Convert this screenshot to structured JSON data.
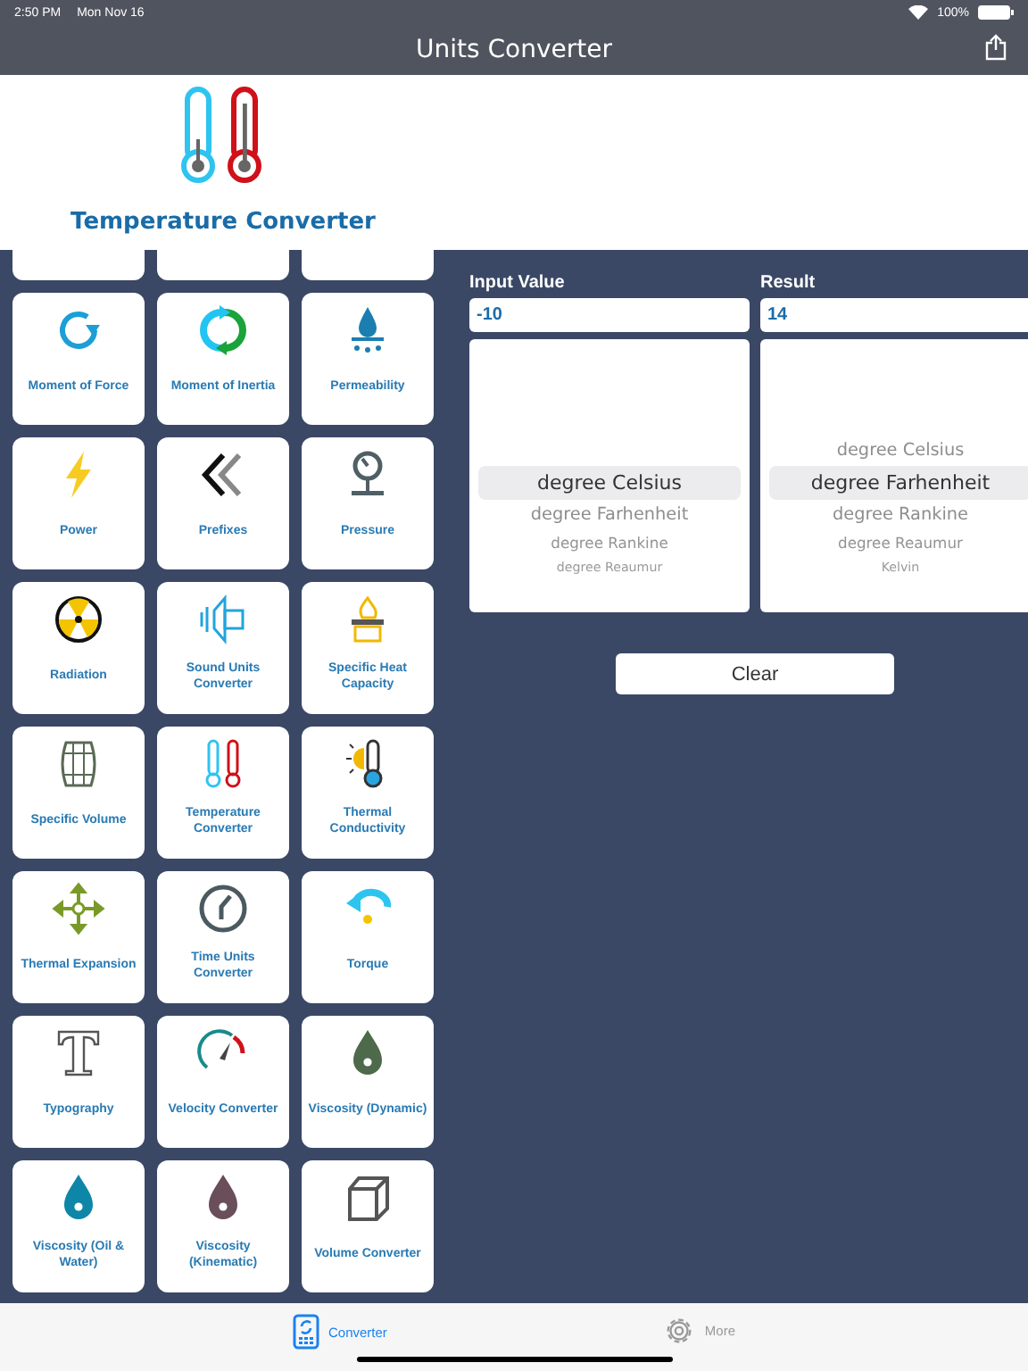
{
  "status_bar": {
    "time": "2:50 PM",
    "date": "Mon Nov 16",
    "battery": "100%"
  },
  "nav_bar": {
    "title": "Units Converter"
  },
  "header": {
    "title": "Temperature Converter"
  },
  "categories": [
    {
      "label": "Moment of Force"
    },
    {
      "label": "Moment of Inertia"
    },
    {
      "label": "Permeability"
    },
    {
      "label": "Power"
    },
    {
      "label": "Prefixes"
    },
    {
      "label": "Pressure"
    },
    {
      "label": "Radiation"
    },
    {
      "label": "Sound Units Converter"
    },
    {
      "label": "Specific Heat Capacity"
    },
    {
      "label": "Specific Volume"
    },
    {
      "label": "Temperature Converter"
    },
    {
      "label": "Thermal Conductivity"
    },
    {
      "label": "Thermal Expansion"
    },
    {
      "label": "Time Units Converter"
    },
    {
      "label": "Torque"
    },
    {
      "label": "Typography"
    },
    {
      "label": "Velocity Converter"
    },
    {
      "label": "Viscosity (Dynamic)"
    },
    {
      "label": "Viscosity (Oil & Water)"
    },
    {
      "label": "Viscosity (Kinematic)"
    },
    {
      "label": "Volume Converter"
    }
  ],
  "input": {
    "label": "Input Value",
    "value": "-10",
    "units": [
      {
        "name": "degree Celsius",
        "selected": true
      },
      {
        "name": "degree Farhenheit",
        "selected": false
      },
      {
        "name": "degree Rankine",
        "selected": false
      },
      {
        "name": "degree Reaumur",
        "selected": false
      }
    ]
  },
  "result": {
    "label": "Result",
    "value": "14",
    "units": [
      {
        "name": "degree Celsius",
        "selected": false
      },
      {
        "name": "degree Farhenheit",
        "selected": true
      },
      {
        "name": "degree Rankine",
        "selected": false
      },
      {
        "name": "degree Reaumur",
        "selected": false
      },
      {
        "name": "Kelvin",
        "selected": false
      }
    ]
  },
  "clear_button": "Clear",
  "tab_bar": [
    {
      "label": "Converter",
      "selected": true
    },
    {
      "label": "More",
      "selected": false
    }
  ]
}
